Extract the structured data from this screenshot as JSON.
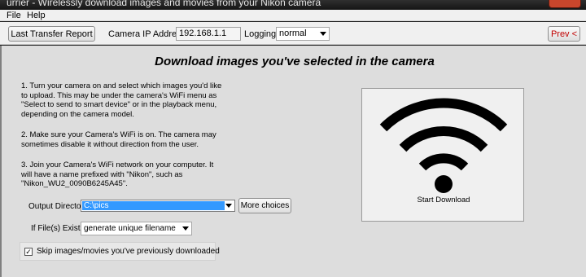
{
  "window": {
    "title": "urrier - Wirelessly download images and movies from your Nikon camera"
  },
  "menu": [
    "File",
    "Help"
  ],
  "toolbar": {
    "last_transfer_label": "Last Transfer Report",
    "camera_ip_label": "Camera IP Address:",
    "camera_ip_value": "192.168.1.1",
    "logging_label": "Logging:",
    "logging_value": "normal",
    "prev_label": "Prev <"
  },
  "main": {
    "heading": "Download images you've selected in the camera",
    "instructions": [
      "1. Turn your camera on and select which images you'd like to upload. This may be under the camera's WiFi menu as \"Select to send to smart device\" or in the playback menu, depending on the camera model.",
      "2. Make sure your Camera's WiFi is on. The camera may sometimes disable it without direction from the user.",
      "3. Join your Camera's WiFi network on your computer. It will have a name prefixed with \"Nikon\", such as \"Nikon_WU2_0090B6245A45\"."
    ],
    "output_dir_label": "Output Directory:",
    "output_dir_value": "C:\\pics",
    "more_choices_label": "More choices",
    "file_exists_label": "If File(s) Exists:",
    "file_exists_value": "generate unique filename",
    "skip_label": "Skip images/movies you've previously downloaded",
    "skip_checked_mark": "✓",
    "start_download_label": "Start Download"
  }
}
